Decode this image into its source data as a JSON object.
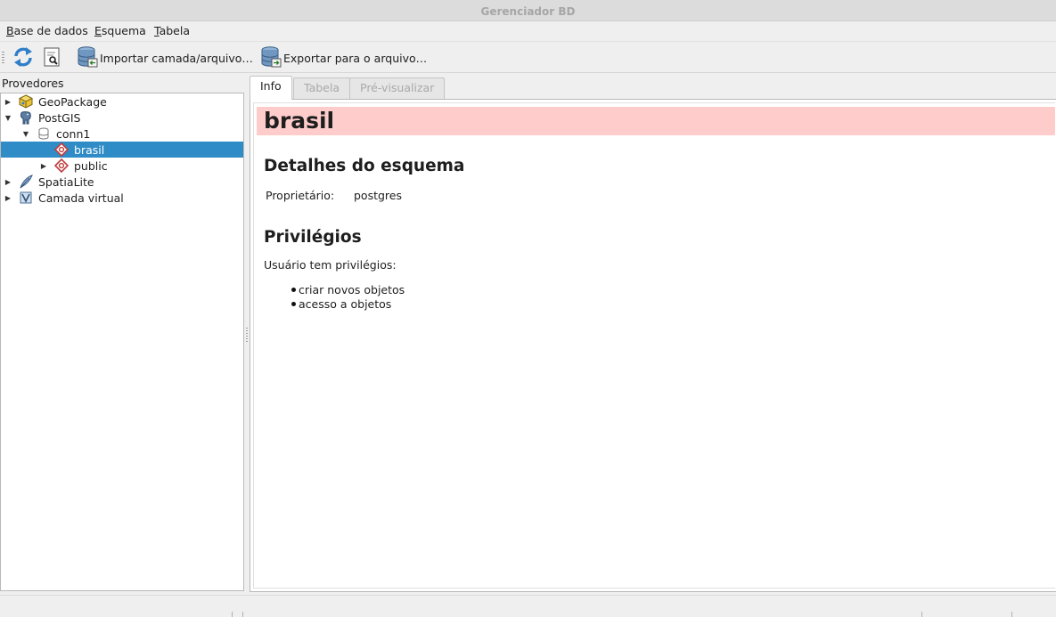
{
  "window": {
    "title": "Gerenciador BD"
  },
  "menubar": {
    "items": [
      {
        "label": "Base de dados",
        "mnemonic": "B",
        "rest": "ase de dados"
      },
      {
        "label": "Esquema",
        "mnemonic": "E",
        "rest": "squema"
      },
      {
        "label": "Tabela",
        "mnemonic": "T",
        "rest": "abela"
      }
    ]
  },
  "toolbar": {
    "refresh_icon": "refresh-icon",
    "sql_icon": "sql-window-icon",
    "import_label": "Importar camada/arquivo…",
    "export_label": "Exportar para o arquivo…"
  },
  "providers": {
    "label": "Provedores",
    "tree": [
      {
        "label": "GeoPackage",
        "icon": "geopackage-icon"
      },
      {
        "label": "PostGIS",
        "icon": "postgis-elephant-icon"
      },
      {
        "label": "conn1",
        "icon": "database-icon"
      },
      {
        "label": "brasil",
        "icon": "schema-icon"
      },
      {
        "label": "public",
        "icon": "schema-icon"
      },
      {
        "label": "SpatiaLite",
        "icon": "spatialite-feather-icon"
      },
      {
        "label": "Camada virtual",
        "icon": "virtual-layer-icon"
      }
    ]
  },
  "tabs": [
    {
      "label": "Info",
      "active": true
    },
    {
      "label": "Tabela",
      "active": false
    },
    {
      "label": "Pré-visualizar",
      "active": false
    }
  ],
  "info": {
    "title": "brasil",
    "header_color": "#ffcccc",
    "schema_details_heading": "Detalhes do esquema",
    "owner_key": "Proprietário:",
    "owner_value": "postgres",
    "privileges_heading": "Privilégios",
    "privileges_intro": "Usuário tem privilégios:",
    "privileges": [
      "criar novos objetos",
      "acesso a objetos"
    ]
  },
  "colors": {
    "selection": "#308cc6",
    "header_band": "#ffcccc"
  }
}
